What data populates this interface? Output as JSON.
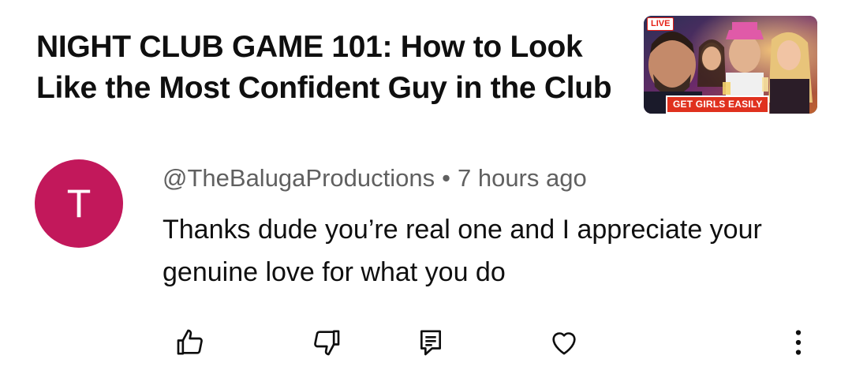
{
  "video": {
    "title": "NIGHT CLUB GAME 101: How to Look Like the Most Confident Guy in the Club",
    "thumbnail": {
      "live_badge": "LIVE",
      "banner_text": "GET GIRLS EASILY"
    }
  },
  "comment": {
    "avatar_letter": "T",
    "avatar_color": "#c2185b",
    "author": "@TheBalugaProductions",
    "separator": "•",
    "timestamp": "7 hours ago",
    "text": "Thanks dude you’re real one and I appreciate your genuine love for what you do"
  },
  "actions": {
    "like_icon": "thumbs-up-icon",
    "dislike_icon": "thumbs-down-icon",
    "reply_icon": "comment-icon",
    "heart_icon": "heart-icon",
    "more_icon": "more-vertical-icon"
  }
}
